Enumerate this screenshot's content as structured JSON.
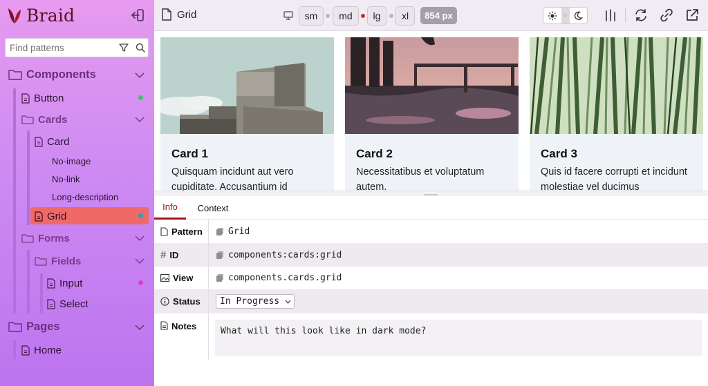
{
  "app": {
    "name": "Braid"
  },
  "search": {
    "placeholder": "Find patterns"
  },
  "nav": {
    "components": "Components",
    "button": "Button",
    "cards": "Cards",
    "card": "Card",
    "no_image": "No-image",
    "no_link": "No-link",
    "long_description": "Long-description",
    "grid": "Grid",
    "forms": "Forms",
    "fields": "Fields",
    "input": "Input",
    "select": "Select",
    "pages": "Pages",
    "home": "Home"
  },
  "status_colors": {
    "button": "#3ec46d",
    "grid": "#2f9bc4",
    "input": "#d63fc9"
  },
  "toolbar": {
    "title": "Grid",
    "breakpoints": [
      "sm",
      "md",
      "lg",
      "xl"
    ],
    "width_badge": "854 px",
    "theme_mid": "○"
  },
  "cards": [
    {
      "title": "Card 1",
      "desc": "Quisquam incidunt aut vero cupiditate. Accusantium id"
    },
    {
      "title": "Card 2",
      "desc": "Necessitatibus et voluptatum autem."
    },
    {
      "title": "Card 3",
      "desc": "Quis id facere corrupti et incidunt molestiae vel ducimus"
    }
  ],
  "tabs": {
    "info": "Info",
    "context": "Context"
  },
  "info": {
    "pattern_label": "Pattern",
    "pattern_value": "Grid",
    "id_label": "ID",
    "id_value": "components:cards:grid",
    "view_label": "View",
    "view_value": "components.cards.grid",
    "status_label": "Status",
    "status_value": "In Progress",
    "notes_label": "Notes",
    "notes_value": "What will this look like in dark mode?"
  },
  "colors": {
    "accent": "#a0161b",
    "selected": "#ef6a67"
  }
}
